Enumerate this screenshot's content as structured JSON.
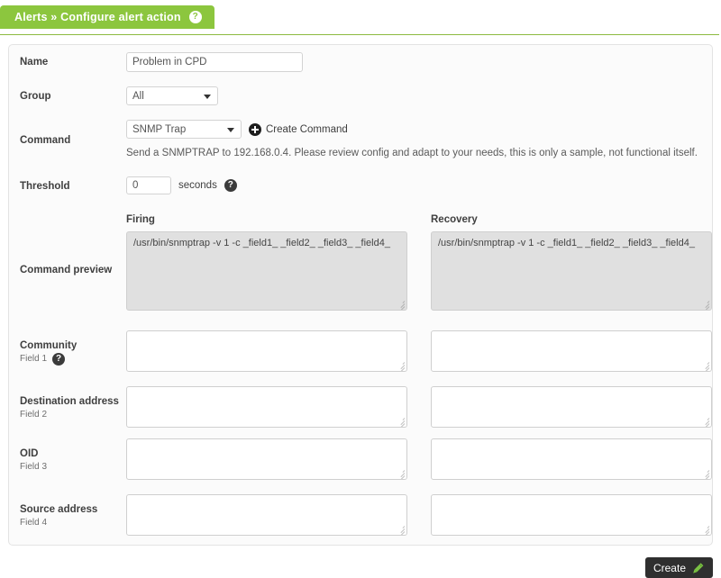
{
  "header": {
    "tab_label": "Alerts » Configure alert action",
    "help_icon": "help-icon",
    "accent_color": "#8cc63e"
  },
  "form": {
    "name": {
      "label": "Name",
      "value": "Problem in CPD",
      "placeholder": ""
    },
    "group": {
      "label": "Group",
      "selected": "All"
    },
    "command": {
      "label": "Command",
      "selected": "SNMP Trap",
      "create_command_label": "Create Command",
      "create_command_icon": "plus-circle-icon",
      "description": "Send a SNMPTRAP to 192.168.0.4. Please review config and adapt to your needs, this is only a sample, not functional itself."
    },
    "threshold": {
      "label": "Threshold",
      "value": "0",
      "units": "seconds",
      "help_icon": "help-icon"
    },
    "columns": {
      "firing": "Firing",
      "recovery": "Recovery"
    },
    "command_preview": {
      "label": "Command preview",
      "firing_value": "/usr/bin/snmptrap -v 1 -c _field1_ _field2_ _field3_ _field4_",
      "recovery_value": "/usr/bin/snmptrap -v 1 -c _field1_ _field2_ _field3_ _field4_"
    },
    "fields": [
      {
        "label": "Community",
        "sublabel": "Field 1",
        "help_icon": "help-icon",
        "firing_value": "",
        "recovery_value": ""
      },
      {
        "label": "Destination address",
        "sublabel": "Field 2",
        "help_icon": "",
        "firing_value": "",
        "recovery_value": ""
      },
      {
        "label": "OID",
        "sublabel": "Field 3",
        "help_icon": "",
        "firing_value": "",
        "recovery_value": ""
      },
      {
        "label": "Source address",
        "sublabel": "Field 4",
        "help_icon": "",
        "firing_value": "",
        "recovery_value": ""
      }
    ]
  },
  "footer": {
    "create_label": "Create",
    "create_icon": "wand-icon",
    "button_color": "#2f2f2f",
    "icon_color": "#7ac143"
  }
}
